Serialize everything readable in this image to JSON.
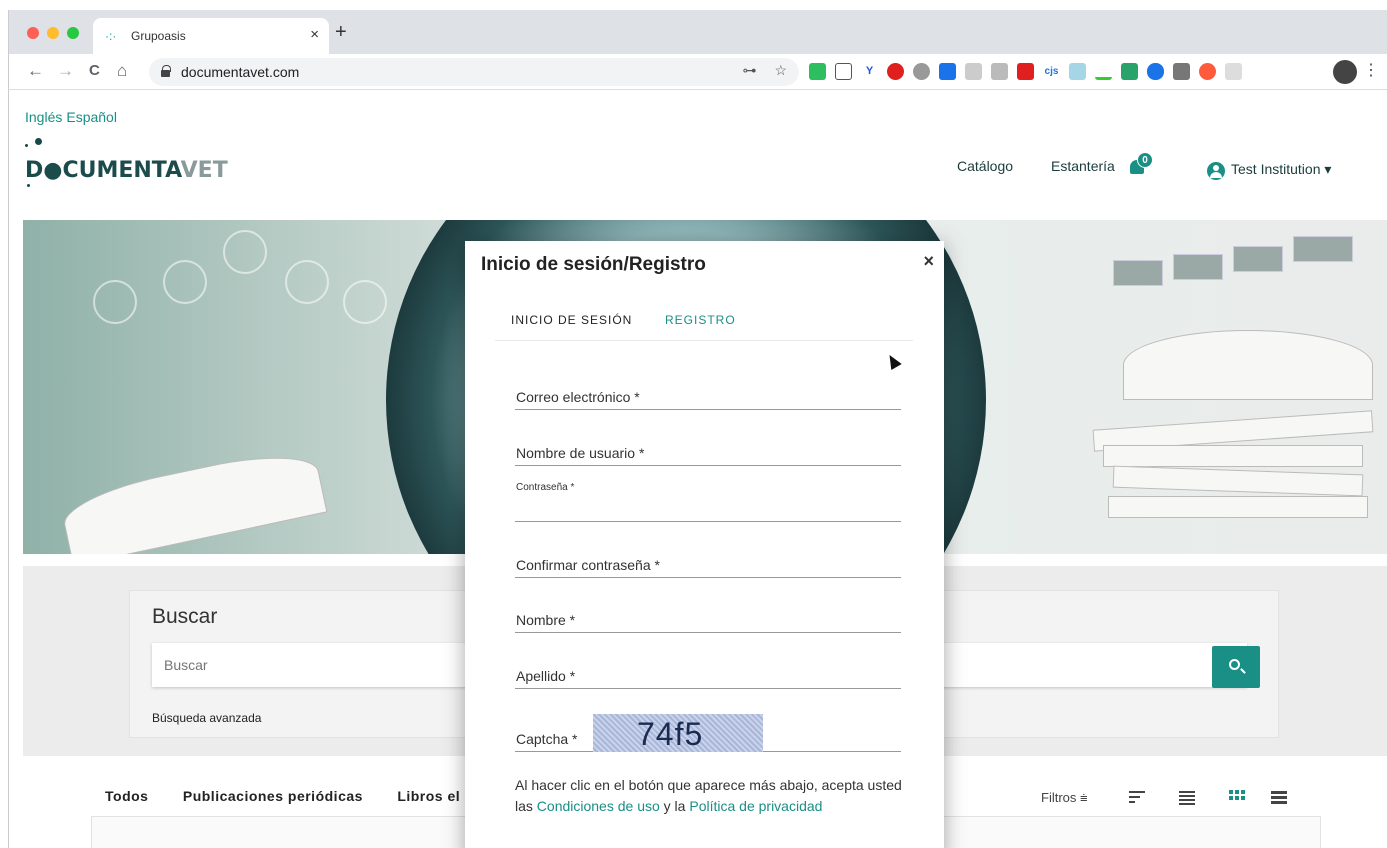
{
  "browser": {
    "tab_title": "Grupoasis",
    "tab_close": "×",
    "new_tab": "+",
    "url": "documentavet.com",
    "nav_back": "←",
    "nav_forward": "→",
    "nav_reload": "C",
    "nav_home": "⌂",
    "key_icon": "⊶",
    "star_icon": "☆",
    "menu": "⋮"
  },
  "header": {
    "lang_ingles": "Inglés",
    "lang_espanol": "Español",
    "logo_main": "D●CUMENTA",
    "logo_vet": "VET",
    "nav_catalogo": "Catálogo",
    "nav_estanteria": "Estantería",
    "notification_count": "0",
    "user_name": "Test Institution ▾"
  },
  "search": {
    "title": "Buscar",
    "placeholder": "Buscar",
    "advanced": "Búsqueda avanzada"
  },
  "filters": {
    "tabs": [
      "Todos",
      "Publicaciones periódicas",
      "Libros el"
    ],
    "filtros_label": "Filtros ⩧"
  },
  "modal": {
    "title": "Inicio de sesión/Registro",
    "close": "×",
    "tab_login": "INICIO DE SESIÓN",
    "tab_register": "REGISTRO",
    "fields": {
      "email": "Correo electrónico *",
      "username": "Nombre de usuario *",
      "password": "Contraseña *",
      "confirm_password": "Confirmar contraseña *",
      "first_name": "Nombre *",
      "last_name": "Apellido *",
      "captcha": "Captcha *"
    },
    "captcha_code": "74f5",
    "terms_prefix": "Al hacer clic en el botón que aparece más abajo, acepta usted las ",
    "terms_link": "Condiciones de uso",
    "terms_and": " y la ",
    "privacy_link": "Política de privacidad"
  },
  "colors": {
    "accent": "#1a8f85",
    "logo": "#1c4b4b"
  }
}
